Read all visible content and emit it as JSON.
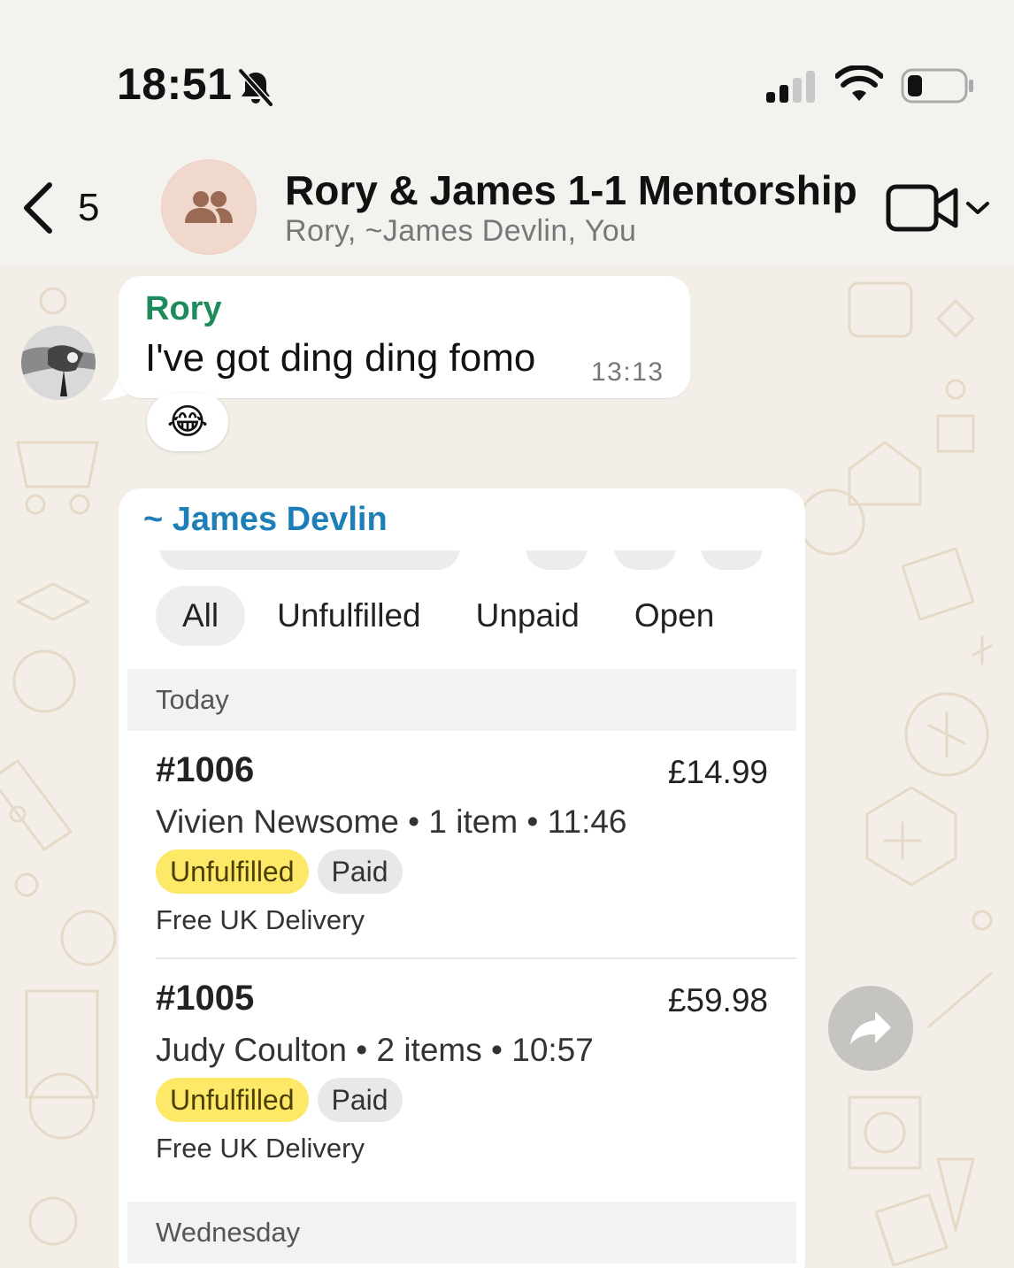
{
  "status_bar": {
    "time": "18:51",
    "icons": [
      "bell-slash-icon",
      "cellular-signal-icon",
      "wifi-icon",
      "battery-icon"
    ]
  },
  "header": {
    "back_count": "5",
    "title": "Rory & James 1-1 Mentorship",
    "subtitle": "Rory, ~James Devlin, You"
  },
  "messages": [
    {
      "sender": "Rory",
      "text": "I've got ding ding fomo",
      "time": "13:13",
      "reaction": "😂"
    },
    {
      "sender": "~ James Devlin",
      "attachment": {
        "tabs": [
          "All",
          "Unfulfilled",
          "Unpaid",
          "Open"
        ],
        "active_tab": "All",
        "sections": [
          {
            "label": "Today",
            "orders": [
              {
                "number": "#1006",
                "total": "£14.99",
                "meta": "Vivien Newsome • 1 item • 11:46",
                "fulfillment": "Unfulfilled",
                "payment": "Paid",
                "delivery": "Free UK Delivery"
              },
              {
                "number": "#1005",
                "total": "£59.98",
                "meta": "Judy Coulton • 2 items • 10:57",
                "fulfillment": "Unfulfilled",
                "payment": "Paid",
                "delivery": "Free UK Delivery"
              }
            ]
          },
          {
            "label": "Wednesday",
            "orders": []
          }
        ]
      }
    }
  ],
  "colors": {
    "rory_name": "#1f8a5b",
    "james_name": "#1e7eb8",
    "unfulfilled_badge": "#fde868",
    "paid_badge": "#e8e8e8",
    "wallpaper": "#f3efe8"
  }
}
